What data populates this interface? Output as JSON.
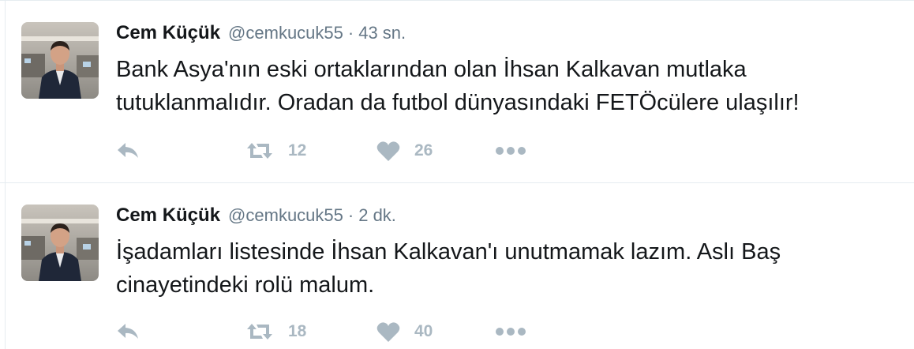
{
  "tweets": [
    {
      "author_name": "Cem Küçük",
      "handle": "@cemkucuk55",
      "separator": "·",
      "time": "43 sn.",
      "text": "Bank Asya'nın eski ortaklarından olan İhsan Kalkavan mutlaka tutuklanmalıdır. Oradan da futbol dünyasındaki FETÖcülere ulaşılır!",
      "retweets": "12",
      "likes": "26"
    },
    {
      "author_name": "Cem Küçük",
      "handle": "@cemkucuk55",
      "separator": "·",
      "time": "2 dk.",
      "text": "İşadamları listesinde İhsan Kalkavan'ı unutmamak lazım. Aslı Baş cinayetindeki rolü malum.",
      "retweets": "18",
      "likes": "40"
    }
  ],
  "icons": {
    "reply": "reply-icon",
    "retweet": "retweet-icon",
    "like": "heart-icon",
    "more": "more-dots-icon"
  },
  "colors": {
    "text": "#14171a",
    "secondary": "#657786",
    "action_icon": "#aab8c2",
    "divider": "#e6ecf0"
  }
}
